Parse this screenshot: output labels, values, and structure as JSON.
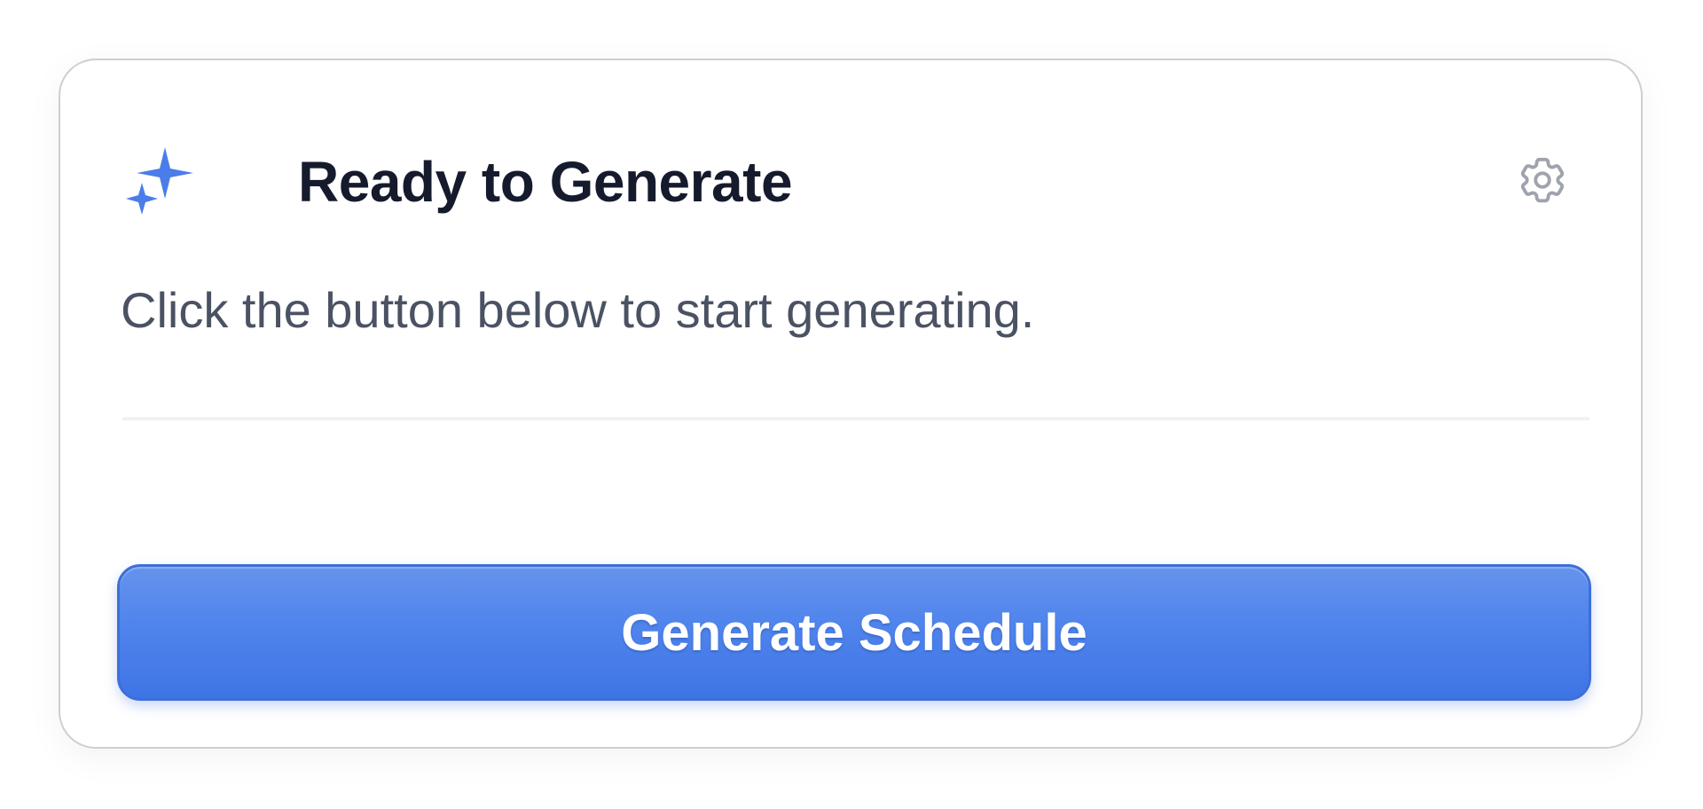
{
  "card": {
    "title": "Ready to Generate",
    "subtitle": "Click the button below to start generating.",
    "header_icon": "sparkle-icon",
    "settings_icon": "gear-icon",
    "generate_button_label": "Generate Schedule"
  },
  "colors": {
    "accent": "#4a7de9",
    "title_text": "#151b2c",
    "body_text": "#4a5263",
    "settings_icon": "#9ea3ad",
    "card_border": "#cfcfd2"
  }
}
